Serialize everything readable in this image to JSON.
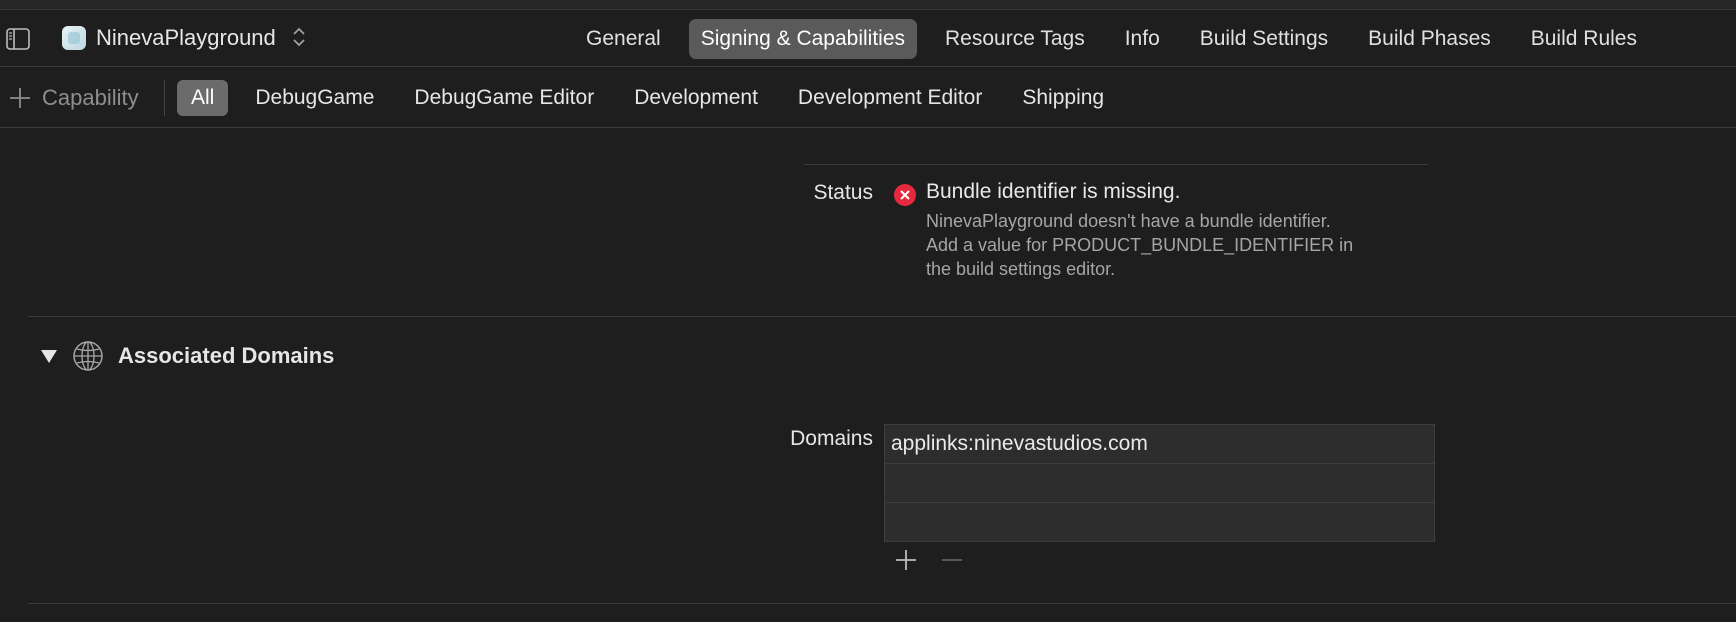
{
  "header": {
    "target_name": "NinevaPlayground",
    "tabs": [
      {
        "label": "General",
        "selected": false
      },
      {
        "label": "Signing & Capabilities",
        "selected": true
      },
      {
        "label": "Resource Tags",
        "selected": false
      },
      {
        "label": "Info",
        "selected": false
      },
      {
        "label": "Build Settings",
        "selected": false
      },
      {
        "label": "Build Phases",
        "selected": false
      },
      {
        "label": "Build Rules",
        "selected": false
      }
    ]
  },
  "filterbar": {
    "add_label": "Capability",
    "filters": [
      {
        "label": "All",
        "selected": true
      },
      {
        "label": "DebugGame",
        "selected": false
      },
      {
        "label": "DebugGame Editor",
        "selected": false
      },
      {
        "label": "Development",
        "selected": false
      },
      {
        "label": "Development Editor",
        "selected": false
      },
      {
        "label": "Shipping",
        "selected": false
      }
    ]
  },
  "status": {
    "label": "Status",
    "title": "Bundle identifier is missing.",
    "detail_lines": [
      "NinevaPlayground doesn't have a bundle identifier.",
      "Add a value for PRODUCT_BUNDLE_IDENTIFIER in",
      "the build settings editor."
    ]
  },
  "associated_domains": {
    "title": "Associated Domains",
    "domains_label": "Domains",
    "rows": [
      "applinks:ninevastudios.com",
      "",
      ""
    ]
  },
  "icons": {
    "sidebar_toggle": "sidebar-toggle-icon",
    "target": "app-target-icon",
    "chevron": "up-down-chevron-icon",
    "add": "plus-icon",
    "error": "error-x-icon",
    "disclosure": "disclosure-triangle-icon",
    "globe": "globe-icon",
    "remove": "minus-icon"
  },
  "colors": {
    "background": "#1e1e1e",
    "selected_tab": "#5a5a5a",
    "selected_filter": "#6b6b6b",
    "error": "#e5293e",
    "muted_text": "#a6a6a6"
  }
}
